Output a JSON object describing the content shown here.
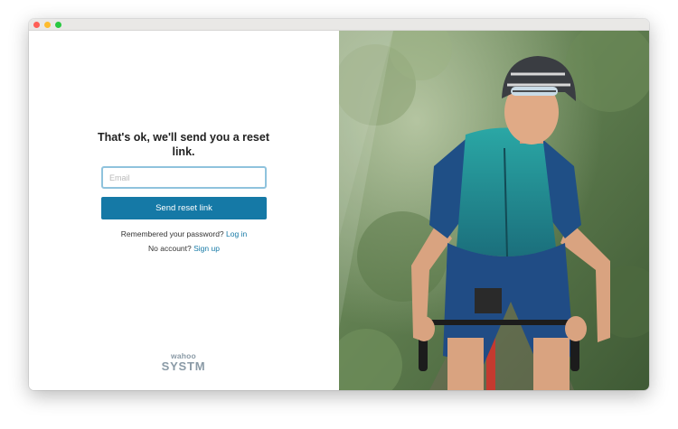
{
  "reset": {
    "heading": "That's ok, we'll send you a reset link.",
    "email_placeholder": "Email",
    "email_value": "",
    "button_label": "Send reset link",
    "remembered_text": "Remembered your password?",
    "login_link": "Log in",
    "no_account_text": "No account?",
    "signup_link": "Sign up"
  },
  "logo": {
    "small": "wahoo",
    "big": "SYSTM"
  },
  "colors": {
    "accent": "#1579a6",
    "input_focus_border": "#8fc3dd",
    "logo": "#8a9aa6"
  },
  "photo": {
    "subject": "cyclist-riding-through-forest"
  }
}
